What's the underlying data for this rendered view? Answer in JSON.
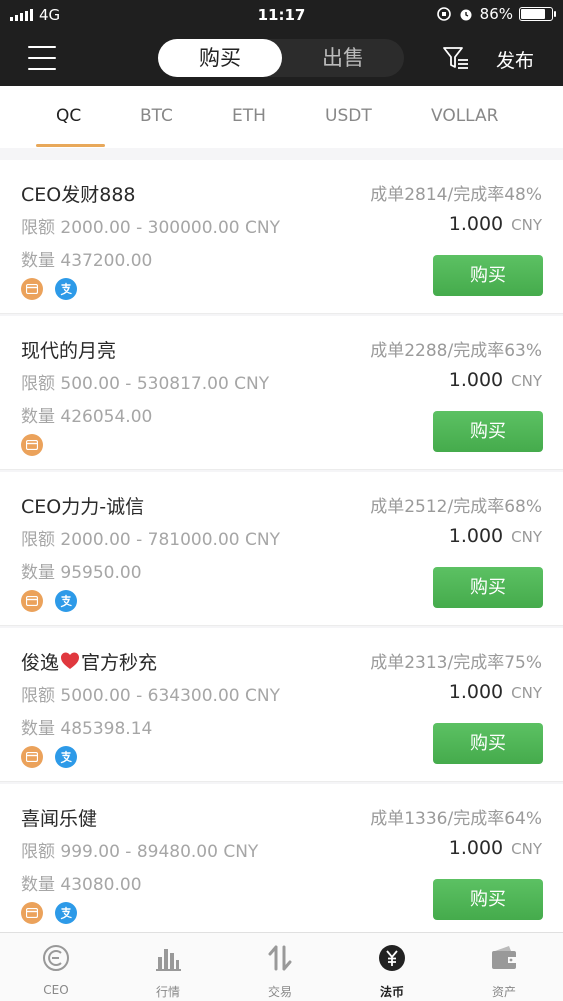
{
  "status": {
    "carrier": "4G",
    "time": "11:17",
    "battery": "86%",
    "battery_level": 0.86
  },
  "header": {
    "buy_label": "购买",
    "sell_label": "出售",
    "publish_label": "发布"
  },
  "tabs": [
    {
      "label": "QC",
      "active": true
    },
    {
      "label": "BTC"
    },
    {
      "label": "ETH"
    },
    {
      "label": "USDT"
    },
    {
      "label": "VOLLAR"
    }
  ],
  "listings": [
    {
      "name": "CEO发财888",
      "stats": "成单2814/完成率48%",
      "limit": "限额 2000.00 - 300000.00 CNY",
      "quantity": "数量 437200.00",
      "price": "1.000",
      "currency": "CNY",
      "payments": [
        "bank-card-icon",
        "alipay-icon"
      ],
      "button": "购买"
    },
    {
      "name": "现代的月亮",
      "stats": "成单2288/完成率63%",
      "limit": "限额 500.00 - 530817.00 CNY",
      "quantity": "数量 426054.00",
      "price": "1.000",
      "currency": "CNY",
      "payments": [
        "bank-card-icon"
      ],
      "button": "购买"
    },
    {
      "name": "CEO力力-诚信",
      "stats": "成单2512/完成率68%",
      "limit": "限额 2000.00 - 781000.00 CNY",
      "quantity": "数量 95950.00",
      "price": "1.000",
      "currency": "CNY",
      "payments": [
        "bank-card-icon",
        "alipay-icon"
      ],
      "button": "购买"
    },
    {
      "name_before": "俊逸",
      "name_after": "官方秒充",
      "stats": "成单2313/完成率75%",
      "limit": "限额 5000.00 - 634300.00 CNY",
      "quantity": "数量 485398.14",
      "price": "1.000",
      "currency": "CNY",
      "payments": [
        "bank-card-icon",
        "alipay-icon"
      ],
      "button": "购买"
    },
    {
      "name": "喜闻乐健",
      "stats": "成单1336/完成率64%",
      "limit": "限额 999.00 - 89480.00 CNY",
      "quantity": "数量 43080.00",
      "price": "1.000",
      "currency": "CNY",
      "payments": [
        "bank-card-icon",
        "alipay-icon"
      ],
      "button": "购买"
    }
  ],
  "nav": [
    {
      "label": "CEO",
      "icon": "ceo-logo-icon"
    },
    {
      "label": "行情",
      "icon": "bar-chart-icon"
    },
    {
      "label": "交易",
      "icon": "swap-icon"
    },
    {
      "label": "法币",
      "icon": "yuan-icon",
      "active": true
    },
    {
      "label": "资产",
      "icon": "wallet-icon"
    }
  ],
  "colors": {
    "accent": "#e8a85a",
    "buy_green": "#4db554",
    "header_bg": "#1f1f1f",
    "alipay_blue": "#2d9ae8",
    "card_orange": "#eba25b"
  }
}
